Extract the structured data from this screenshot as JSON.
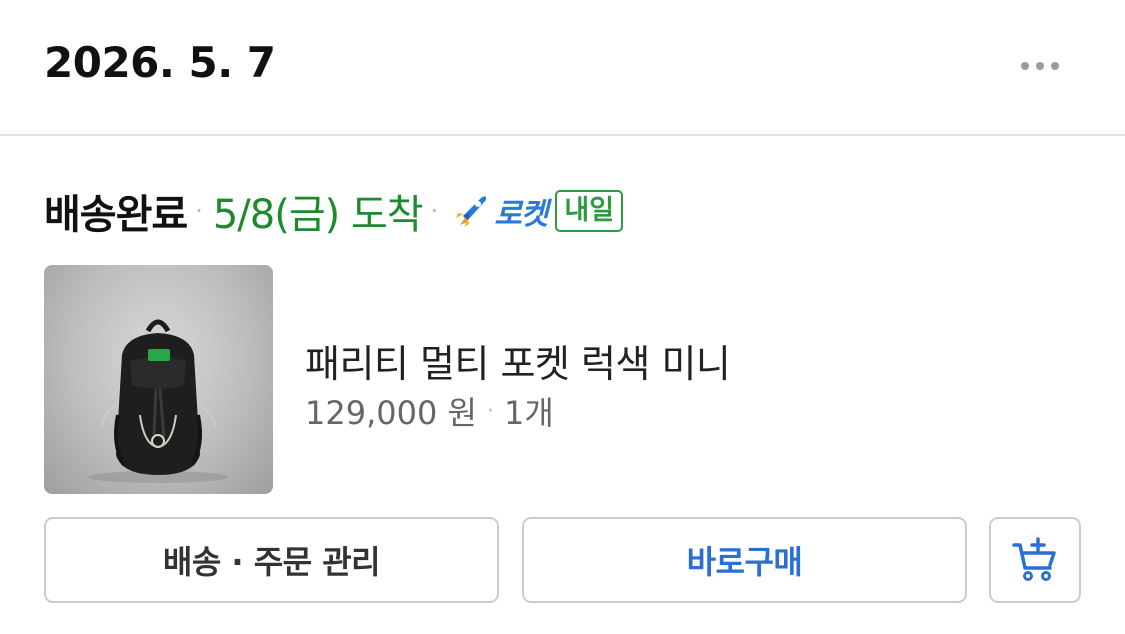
{
  "order": {
    "date": "2026. 5. 7",
    "status": "배송완료",
    "arrival": "5/8(금) 도착",
    "rocket_label": "로켓",
    "delivery_badge": "내일"
  },
  "product": {
    "name": "패리티 멀티 포켓 럭색 미니",
    "price": "129,000 원",
    "quantity": "1개"
  },
  "actions": {
    "manage_label": "배송 · 주문 관리",
    "buy_now_label": "바로구매",
    "cart_icon": "add-to-cart-icon",
    "more_icon": "more-horizontal-icon"
  },
  "colors": {
    "arrival_green": "#1d8a2e",
    "rocket_blue": "#2a7ad9",
    "buy_blue": "#2a6fd6"
  }
}
